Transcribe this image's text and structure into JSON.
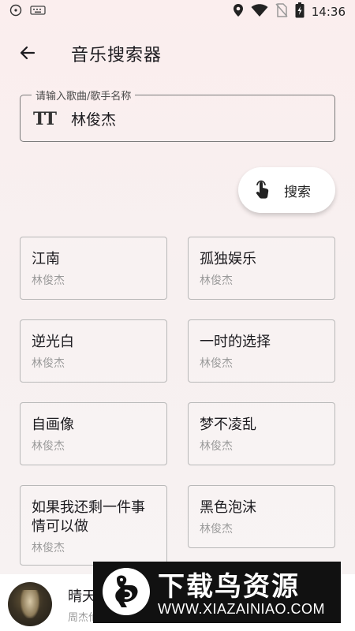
{
  "status_bar": {
    "time": "14:36",
    "icons": [
      "media-icon",
      "keyboard-icon",
      "location-icon",
      "wifi-icon",
      "no-sim-icon",
      "battery-icon"
    ]
  },
  "app_bar": {
    "title": "音乐搜索器",
    "back_icon": "arrow-back-icon"
  },
  "search": {
    "label": "请输入歌曲/歌手名称",
    "value": "林俊杰",
    "field_icon": "text-fields-icon",
    "field_icon_glyph": "TT",
    "button_label": "搜索",
    "button_icon": "touch-hand-icon"
  },
  "results": [
    {
      "title": "江南",
      "artist": "林俊杰"
    },
    {
      "title": "孤独娱乐",
      "artist": "林俊杰"
    },
    {
      "title": "逆光白",
      "artist": "林俊杰"
    },
    {
      "title": "一时的选择",
      "artist": "林俊杰"
    },
    {
      "title": "自画像",
      "artist": "林俊杰"
    },
    {
      "title": "梦不凌乱",
      "artist": "林俊杰"
    },
    {
      "title": "如果我还剩一件事情可以做",
      "artist": "林俊杰"
    },
    {
      "title": "黑色泡沫",
      "artist": "林俊杰"
    }
  ],
  "now_playing": {
    "title": "晴天",
    "artist": "周杰伦"
  },
  "watermark": {
    "title": "下载鸟资源",
    "url": "WWW.XIAZAINIAO.COM"
  },
  "colors": {
    "background": "#fbeeee",
    "card_border": "#b8b8b8",
    "field_border": "#7a7a7a",
    "secondary_text": "#9a9a9a"
  }
}
